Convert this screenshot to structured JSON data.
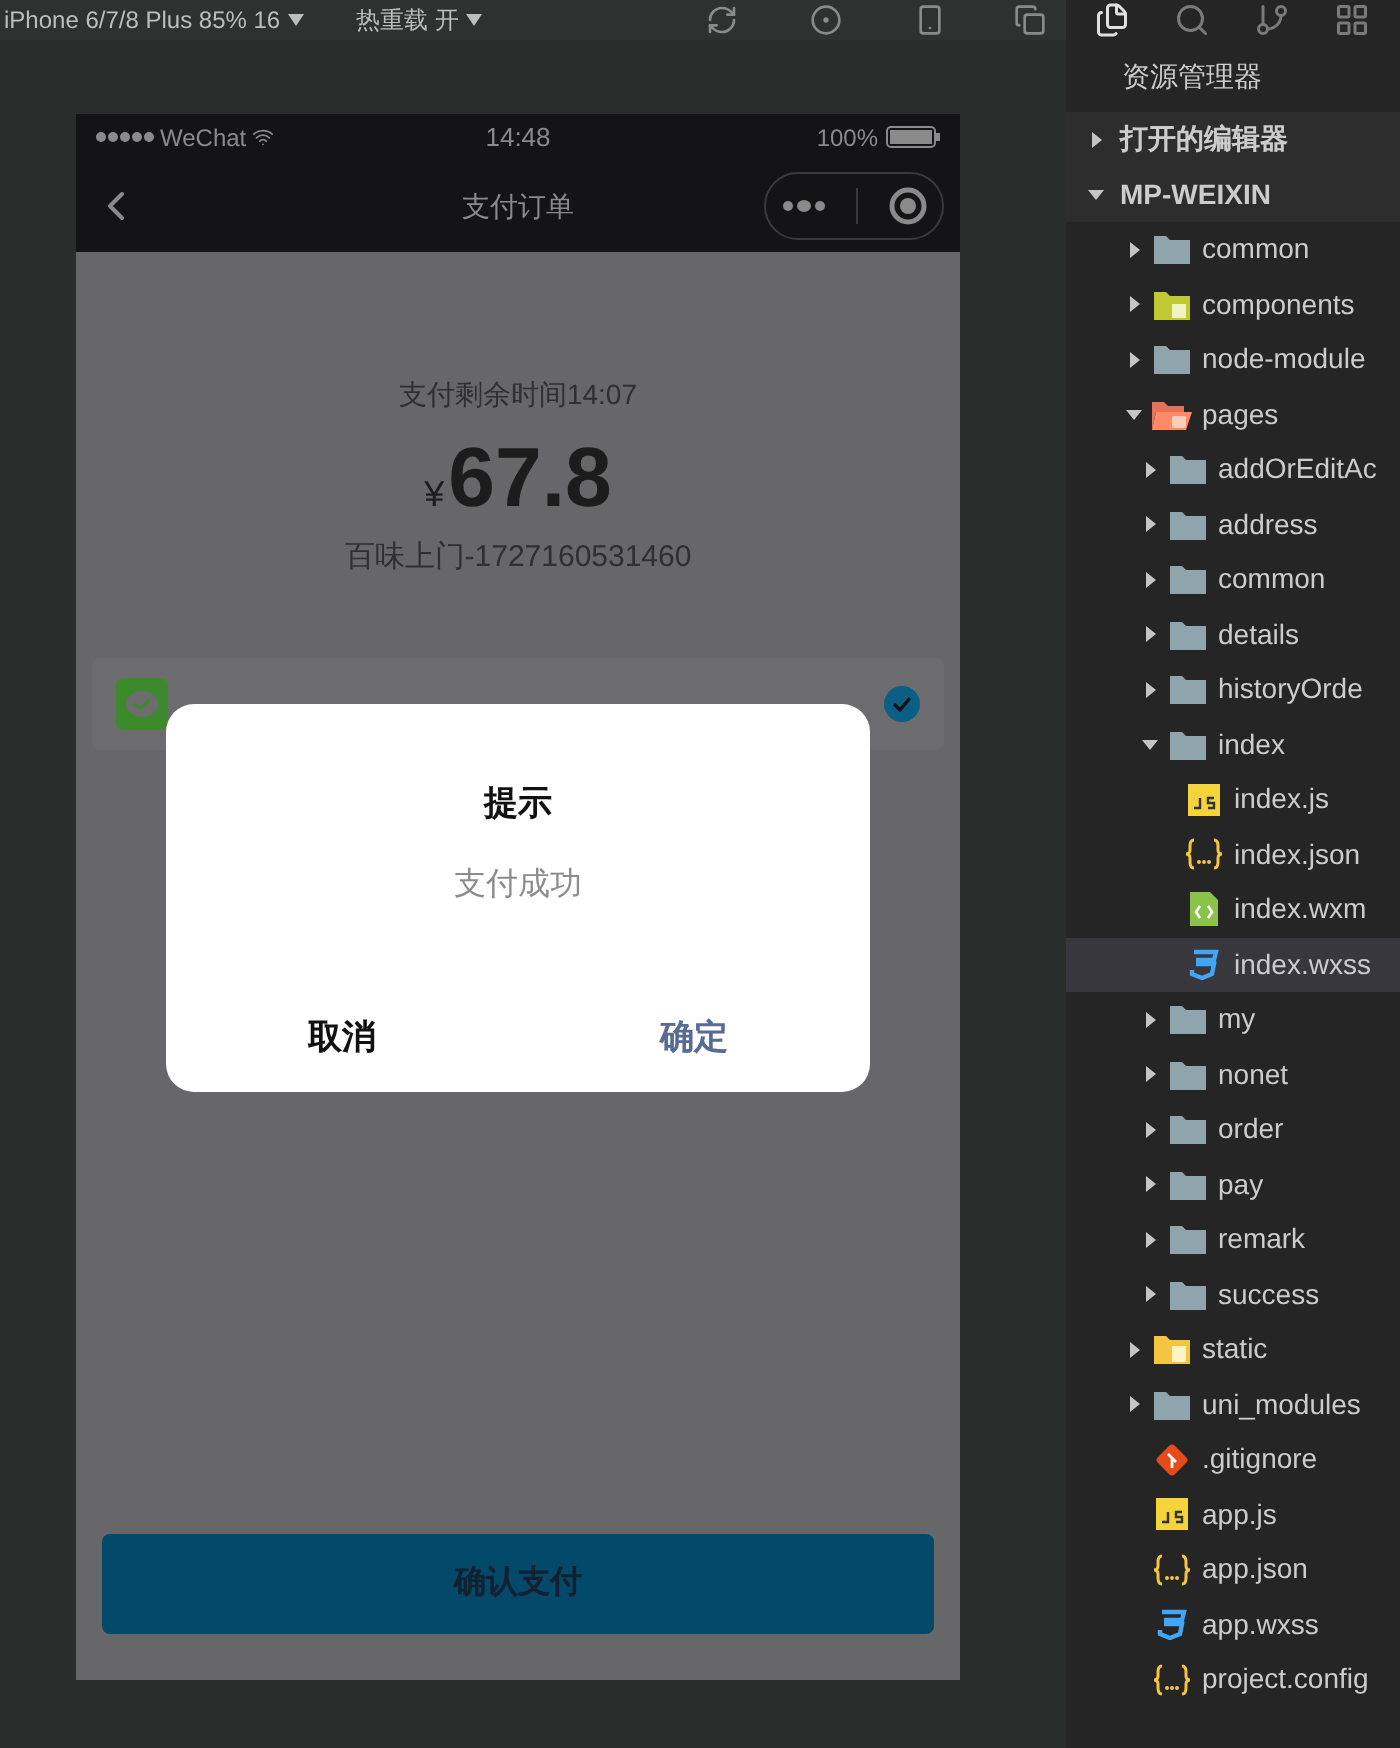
{
  "toolbar": {
    "device": "iPhone 6/7/8 Plus 85% 16",
    "hot_reload": "热重载 开"
  },
  "phone": {
    "status_bar": {
      "carrier": "WeChat",
      "time": "14:48",
      "battery": "100%"
    },
    "nav_title": "支付订单",
    "countdown": "支付剩余时间14:07",
    "currency": "¥",
    "amount": "67.8",
    "order_name": "百味上门-1727160531460",
    "payment_methods": [
      {
        "selected": true
      }
    ],
    "confirm_button": "确认支付",
    "dialog": {
      "title": "提示",
      "message": "支付成功",
      "buttons": [
        {
          "label": "取消",
          "kind": "cancel"
        },
        {
          "label": "确定",
          "kind": "confirm"
        }
      ]
    }
  },
  "explorer": {
    "title": "资源管理器",
    "sections": [
      {
        "label": "打开的编辑器",
        "expanded": false
      },
      {
        "label": "MP-WEIXIN",
        "expanded": true
      }
    ],
    "tree": [
      {
        "label": "common",
        "kind": "folder",
        "expanded": false,
        "selected": false
      },
      {
        "label": "components",
        "kind": "folder-components",
        "expanded": false,
        "selected": false
      },
      {
        "label": "node-module",
        "kind": "folder",
        "expanded": false,
        "selected": false
      },
      {
        "label": "pages",
        "kind": "folder-pages",
        "expanded": true,
        "selected": false,
        "children": [
          {
            "label": "addOrEditAc",
            "kind": "folder",
            "expanded": false,
            "selected": false
          },
          {
            "label": "address",
            "kind": "folder",
            "expanded": false,
            "selected": false
          },
          {
            "label": "common",
            "kind": "folder",
            "expanded": false,
            "selected": false
          },
          {
            "label": "details",
            "kind": "folder",
            "expanded": false,
            "selected": false
          },
          {
            "label": "historyOrde",
            "kind": "folder",
            "expanded": false,
            "selected": false
          },
          {
            "label": "index",
            "kind": "folder",
            "expanded": true,
            "selected": false,
            "children": [
              {
                "label": "index.js",
                "kind": "js",
                "selected": false
              },
              {
                "label": "index.json",
                "kind": "json",
                "selected": false
              },
              {
                "label": "index.wxm",
                "kind": "wxml",
                "selected": false
              },
              {
                "label": "index.wxss",
                "kind": "wxss",
                "selected": true
              }
            ]
          },
          {
            "label": "my",
            "kind": "folder",
            "expanded": false,
            "selected": false
          },
          {
            "label": "nonet",
            "kind": "folder",
            "expanded": false,
            "selected": false
          },
          {
            "label": "order",
            "kind": "folder",
            "expanded": false,
            "selected": false
          },
          {
            "label": "pay",
            "kind": "folder",
            "expanded": false,
            "selected": false
          },
          {
            "label": "remark",
            "kind": "folder",
            "expanded": false,
            "selected": false
          },
          {
            "label": "success",
            "kind": "folder",
            "expanded": false,
            "selected": false
          }
        ]
      },
      {
        "label": "static",
        "kind": "folder-static",
        "expanded": false,
        "selected": false
      },
      {
        "label": "uni_modules",
        "kind": "folder",
        "expanded": false,
        "selected": false
      },
      {
        "label": ".gitignore",
        "kind": "git",
        "selected": false
      },
      {
        "label": "app.js",
        "kind": "js",
        "selected": false
      },
      {
        "label": "app.json",
        "kind": "json",
        "selected": false
      },
      {
        "label": "app.wxss",
        "kind": "wxss",
        "selected": false
      },
      {
        "label": "project.config",
        "kind": "json",
        "selected": false
      }
    ]
  }
}
